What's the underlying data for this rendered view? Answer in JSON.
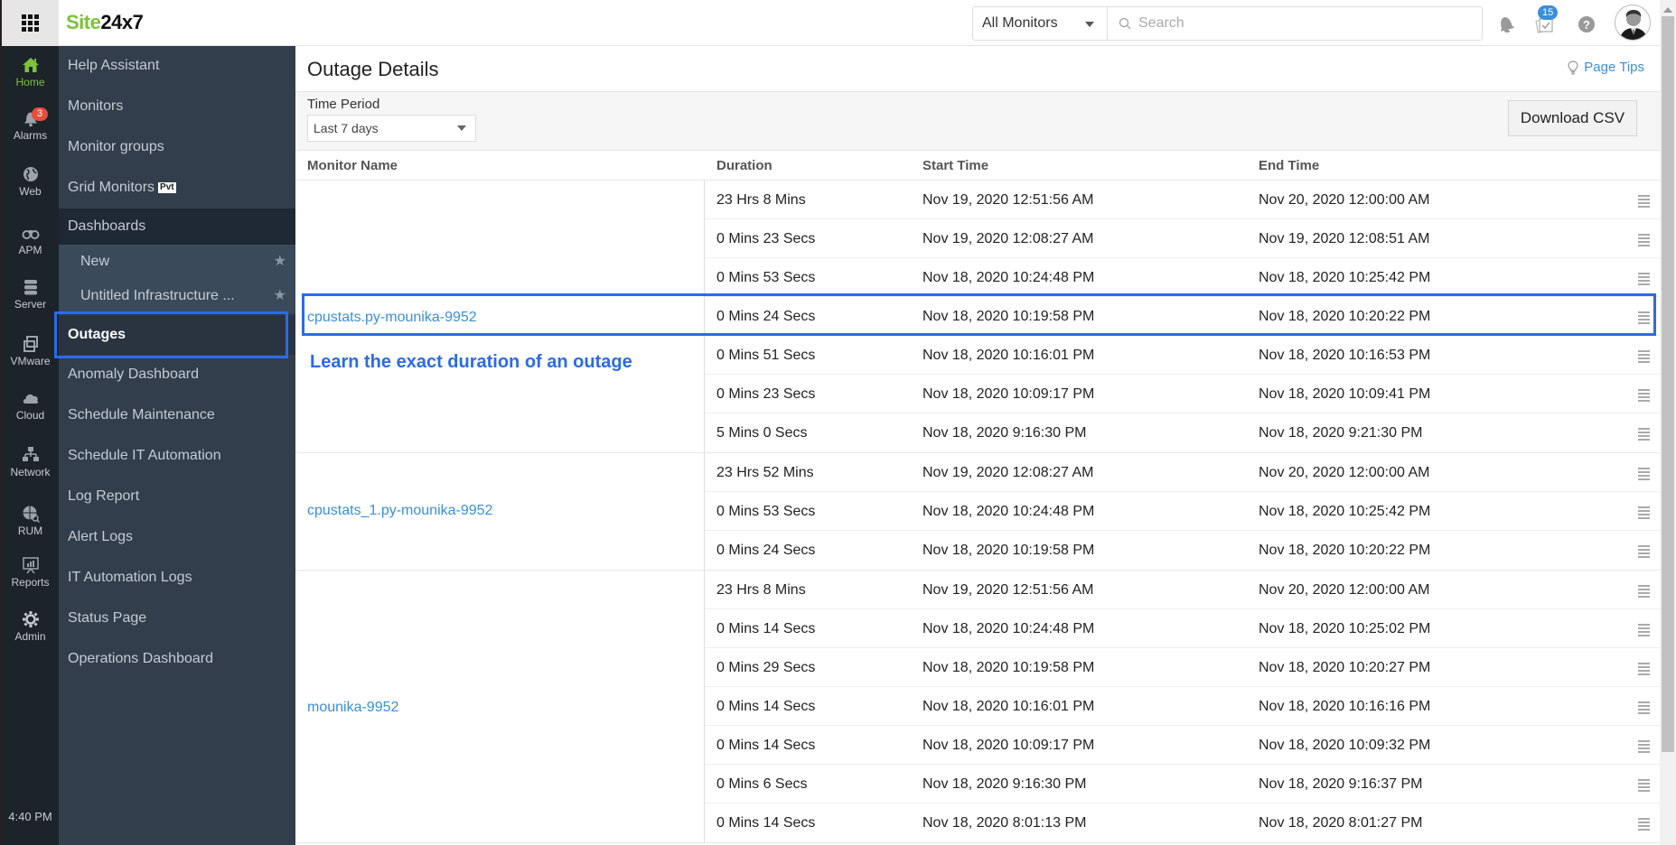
{
  "brand": {
    "logo_green": "Site",
    "logo_dark": "24x7"
  },
  "topbar": {
    "monitor_filter": "All Monitors",
    "search_placeholder": "Search",
    "tasks_badge": "15"
  },
  "rail": {
    "items": [
      {
        "label": "Home",
        "icon": "home-icon",
        "active": true
      },
      {
        "label": "Alarms",
        "icon": "bell-icon",
        "badge": "3"
      },
      {
        "label": "Web",
        "icon": "globe-icon"
      },
      {
        "label": "APM",
        "icon": "binoculars-icon"
      },
      {
        "label": "Server",
        "icon": "server-icon"
      },
      {
        "label": "VMware",
        "icon": "vmware-icon"
      },
      {
        "label": "Cloud",
        "icon": "cloud-icon"
      },
      {
        "label": "Network",
        "icon": "network-icon"
      },
      {
        "label": "RUM",
        "icon": "rum-globe-icon"
      },
      {
        "label": "Reports",
        "icon": "reports-icon"
      },
      {
        "label": "Admin",
        "icon": "gear-icon"
      }
    ],
    "time": "4:40 PM"
  },
  "sidebar": {
    "items": [
      {
        "label": "Help Assistant"
      },
      {
        "label": "Monitors"
      },
      {
        "label": "Monitor groups"
      },
      {
        "label": "Grid Monitors",
        "tag": "Pvt"
      },
      {
        "label": "Dashboards"
      },
      {
        "label": "New"
      },
      {
        "label": "Untitled Infrastructure ..."
      },
      {
        "label": "Outages"
      },
      {
        "label": "Anomaly Dashboard"
      },
      {
        "label": "Schedule Maintenance"
      },
      {
        "label": "Schedule IT Automation"
      },
      {
        "label": "Log Report"
      },
      {
        "label": "Alert Logs"
      },
      {
        "label": "IT Automation Logs"
      },
      {
        "label": "Status Page"
      },
      {
        "label": "Operations Dashboard"
      }
    ]
  },
  "page": {
    "title": "Outage Details",
    "page_tips": "Page Tips",
    "time_period_label": "Time Period",
    "time_period_value": "Last 7 days",
    "download_csv": "Download CSV",
    "annotation": "Learn the exact duration of an outage"
  },
  "table": {
    "headers": {
      "monitor": "Monitor Name",
      "duration": "Duration",
      "start": "Start Time",
      "end": "End Time"
    },
    "groups": [
      {
        "monitor": "cpustats.py-mounika-9952",
        "rows": [
          {
            "duration": "23 Hrs 8 Mins",
            "start": "Nov 19, 2020 12:51:56 AM",
            "end": "Nov 20, 2020 12:00:00 AM"
          },
          {
            "duration": "0 Mins 23 Secs",
            "start": "Nov 19, 2020 12:08:27 AM",
            "end": "Nov 19, 2020 12:08:51 AM"
          },
          {
            "duration": "0 Mins 53 Secs",
            "start": "Nov 18, 2020 10:24:48 PM",
            "end": "Nov 18, 2020 10:25:42 PM"
          },
          {
            "duration": "0 Mins 24 Secs",
            "start": "Nov 18, 2020 10:19:58 PM",
            "end": "Nov 18, 2020 10:20:22 PM"
          },
          {
            "duration": "0 Mins 51 Secs",
            "start": "Nov 18, 2020 10:16:01 PM",
            "end": "Nov 18, 2020 10:16:53 PM"
          },
          {
            "duration": "0 Mins 23 Secs",
            "start": "Nov 18, 2020 10:09:17 PM",
            "end": "Nov 18, 2020 10:09:41 PM"
          },
          {
            "duration": "5 Mins 0 Secs",
            "start": "Nov 18, 2020 9:16:30 PM",
            "end": "Nov 18, 2020 9:21:30 PM"
          }
        ]
      },
      {
        "monitor": "cpustats_1.py-mounika-9952",
        "rows": [
          {
            "duration": "23 Hrs 52 Mins",
            "start": "Nov 19, 2020 12:08:27 AM",
            "end": "Nov 20, 2020 12:00:00 AM"
          },
          {
            "duration": "0 Mins 53 Secs",
            "start": "Nov 18, 2020 10:24:48 PM",
            "end": "Nov 18, 2020 10:25:42 PM"
          },
          {
            "duration": "0 Mins 24 Secs",
            "start": "Nov 18, 2020 10:19:58 PM",
            "end": "Nov 18, 2020 10:20:22 PM"
          }
        ]
      },
      {
        "monitor": "mounika-9952",
        "rows": [
          {
            "duration": "23 Hrs 8 Mins",
            "start": "Nov 19, 2020 12:51:56 AM",
            "end": "Nov 20, 2020 12:00:00 AM"
          },
          {
            "duration": "0 Mins 14 Secs",
            "start": "Nov 18, 2020 10:24:48 PM",
            "end": "Nov 18, 2020 10:25:02 PM"
          },
          {
            "duration": "0 Mins 29 Secs",
            "start": "Nov 18, 2020 10:19:58 PM",
            "end": "Nov 18, 2020 10:20:27 PM"
          },
          {
            "duration": "0 Mins 14 Secs",
            "start": "Nov 18, 2020 10:16:01 PM",
            "end": "Nov 18, 2020 10:16:16 PM"
          },
          {
            "duration": "0 Mins 14 Secs",
            "start": "Nov 18, 2020 10:09:17 PM",
            "end": "Nov 18, 2020 10:09:32 PM"
          },
          {
            "duration": "0 Mins 6 Secs",
            "start": "Nov 18, 2020 9:16:30 PM",
            "end": "Nov 18, 2020 9:16:37 PM"
          },
          {
            "duration": "0 Mins 14 Secs",
            "start": "Nov 18, 2020 8:01:13 PM",
            "end": "Nov 18, 2020 8:01:27 PM"
          }
        ]
      }
    ]
  },
  "colors": {
    "brand_green": "#7cc23a",
    "link_blue": "#3a8fd9",
    "highlight_blue": "#2a6bea",
    "sidebar_bg": "#323e4c",
    "rail_bg": "#1c2329"
  }
}
